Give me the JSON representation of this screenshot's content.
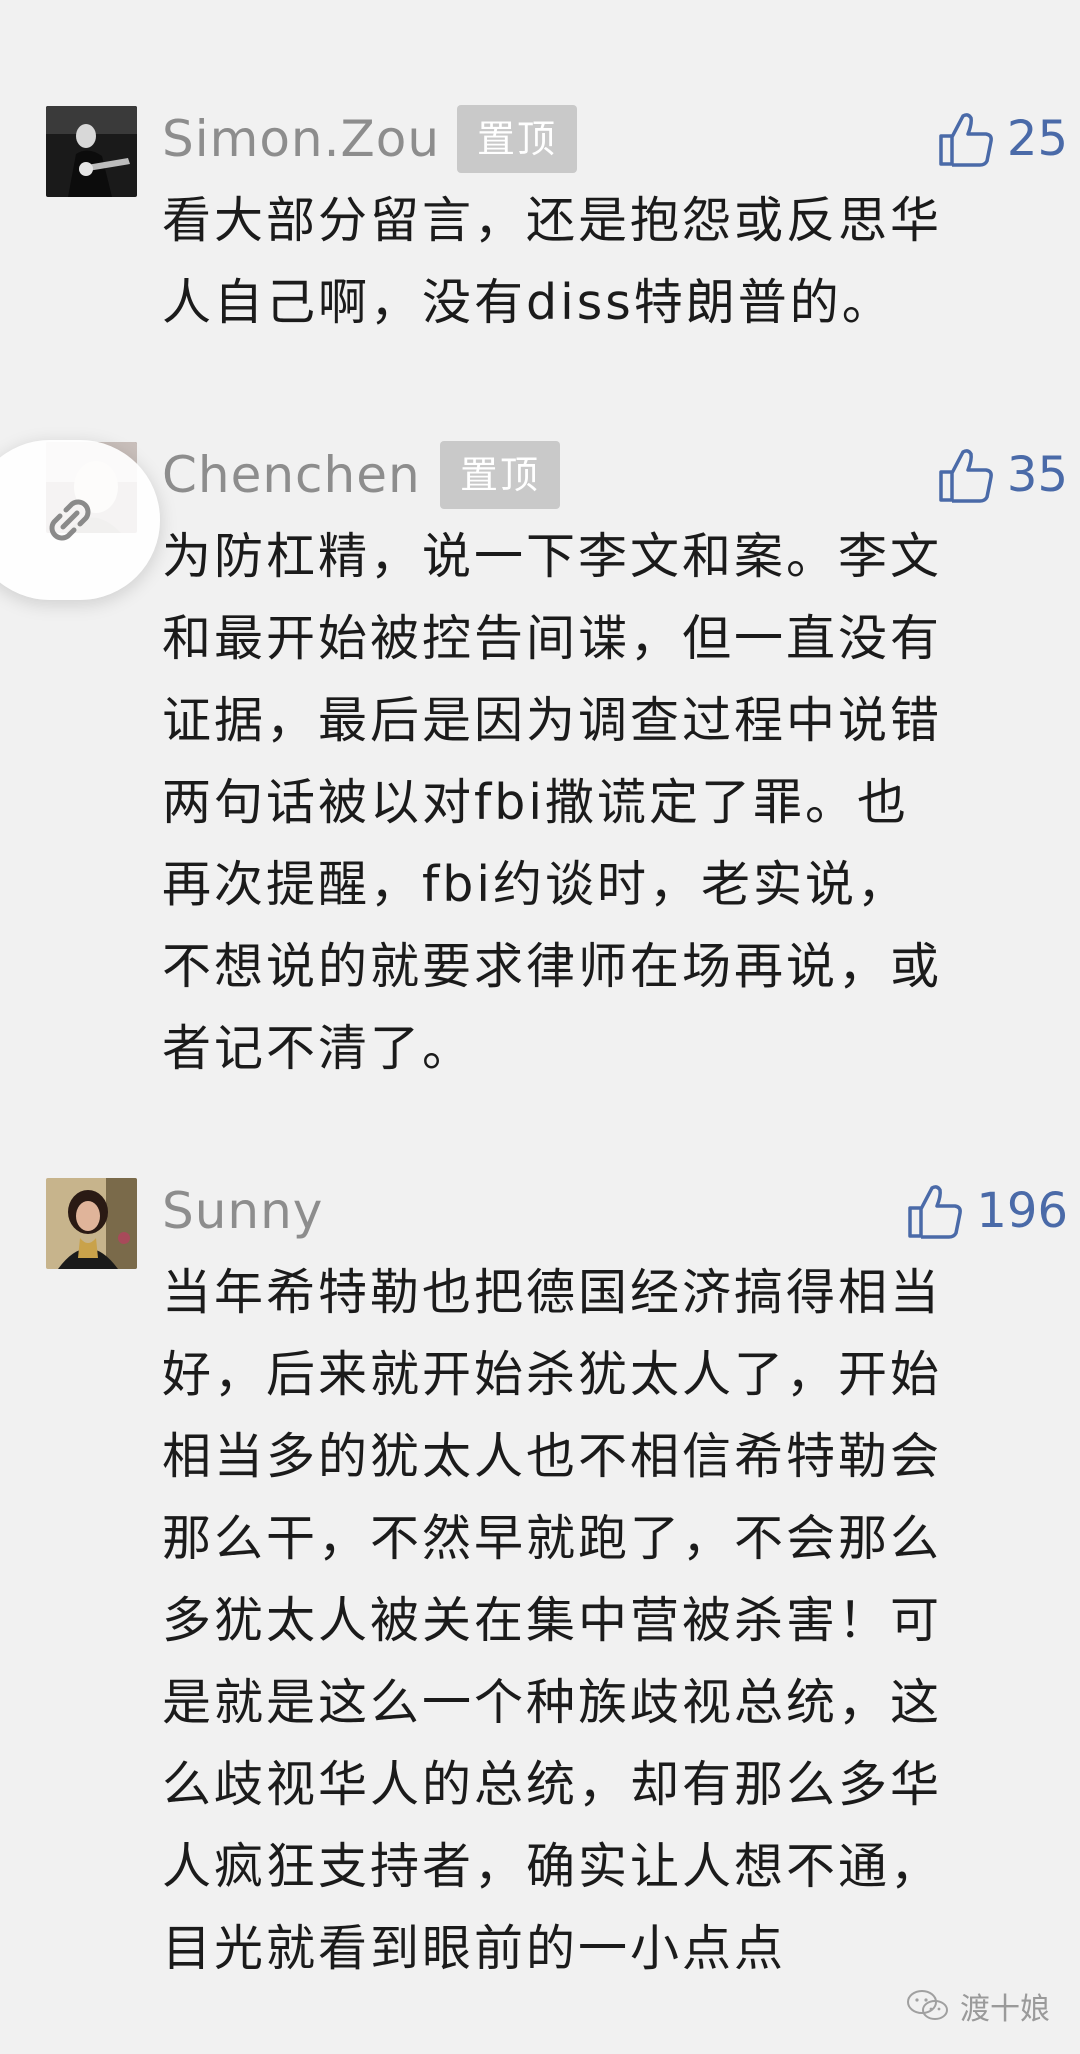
{
  "comments": [
    {
      "name": "Simon.Zou",
      "pinned_label": "置顶",
      "likes": "25",
      "text": "看大部分留言，还是抱怨或反思华\n人自己啊，没有diss特朗普的。"
    },
    {
      "name": "Chenchen",
      "pinned_label": "置顶",
      "likes": "35",
      "text": "为防杠精，说一下李文和案。李文\n和最开始被控告间谍，但一直没有\n证据，最后是因为调查过程中说错\n两句话被以对fbi撒谎定了罪。也\n再次提醒，fbi约谈时，老实说，\n不想说的就要求律师在场再说，或\n者记不清了。"
    },
    {
      "name": "Sunny",
      "likes": "196",
      "text": "当年希特勒也把德国经济搞得相当\n好，后来就开始杀犹太人了，开始\n相当多的犹太人也不相信希特勒会\n那么干，不然早就跑了，不会那么\n多犹太人被关在集中营被杀害！可\n是就是这么一个种族歧视总统，这\n么歧视华人的总统，却有那么多华\n人疯狂支持者，确实让人想不通，\n目光就看到眼前的一小点点"
    }
  ],
  "watermark": {
    "text": "渡十娘",
    "icon": "wechat-icon"
  },
  "share_button": {
    "icon": "link-icon"
  },
  "colors": {
    "like_blue": "#4a6aa8",
    "nickname_gray": "#8d8d8d",
    "badge_gray": "#c9c9c9",
    "background": "#f1f1f1"
  }
}
